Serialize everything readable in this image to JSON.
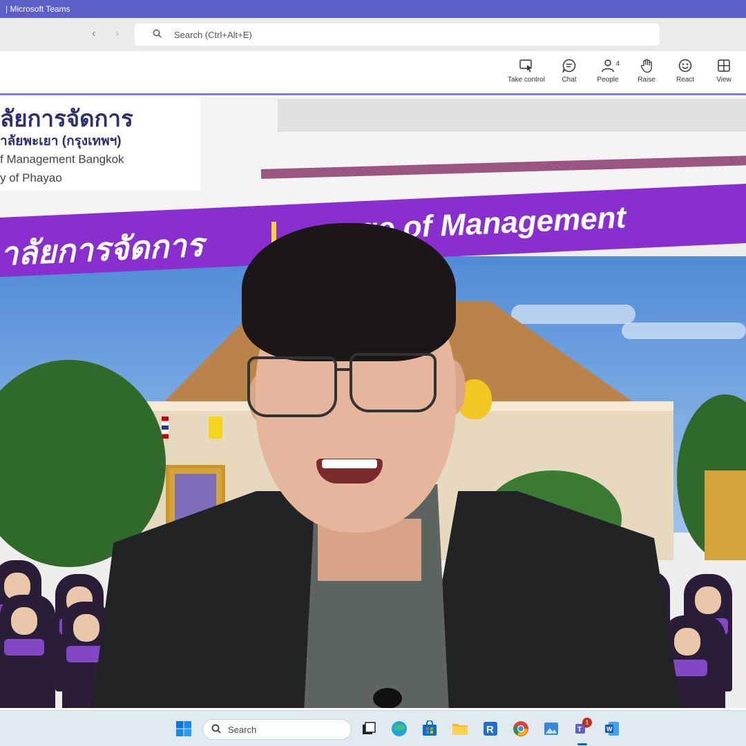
{
  "window": {
    "title": "| Microsoft Teams"
  },
  "nav": {
    "back_glyph": "‹",
    "forward_glyph": "›",
    "search_placeholder": "Search (Ctrl+Alt+E)"
  },
  "toolbar": {
    "items": [
      {
        "label": "Take control",
        "icon": "take-control-icon"
      },
      {
        "label": "Chat",
        "icon": "chat-icon"
      },
      {
        "label": "People",
        "icon": "people-icon",
        "count": "4"
      },
      {
        "label": "Raise",
        "icon": "raise-hand-icon"
      },
      {
        "label": "React",
        "icon": "react-icon"
      },
      {
        "label": "View",
        "icon": "view-icon"
      }
    ]
  },
  "slide": {
    "logo_line1": "ลัยการจัดการ",
    "logo_line2": "าลัยพะเยา (กรุงเทพฯ)",
    "logo_line3": "f Management Bangkok",
    "logo_line4": "y of Phayao",
    "banner_thai": "าลัยการจัดการ",
    "banner_english": "ge of Management"
  },
  "taskbar": {
    "search_label": "Search",
    "teams_badge": "1",
    "apps": [
      "windows-start-icon",
      "search-icon",
      "task-view-icon",
      "edge-icon",
      "store-icon",
      "file-explorer-icon",
      "reader-icon",
      "chrome-icon",
      "photos-icon",
      "teams-icon",
      "word-icon"
    ]
  },
  "colors": {
    "teams_accent": "#5b5fc7",
    "banner_purple": "#8a2fcf",
    "banner_divider": "#ffd23a"
  }
}
